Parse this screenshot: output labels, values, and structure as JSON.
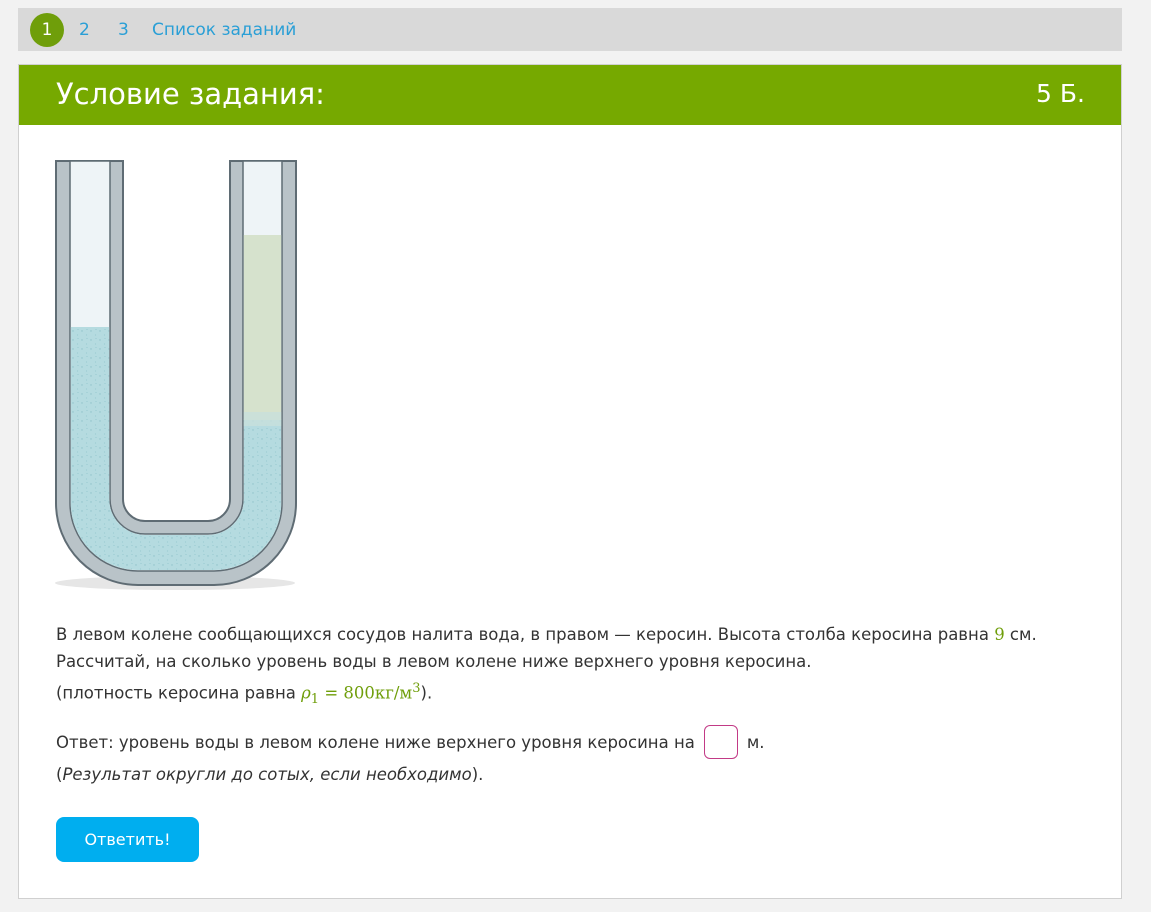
{
  "nav": {
    "tabs": [
      {
        "label": "1",
        "active": true
      },
      {
        "label": "2",
        "active": false
      },
      {
        "label": "3",
        "active": false
      }
    ],
    "task_list": "Список заданий"
  },
  "header": {
    "title": "Условие задания:",
    "points": "5 Б."
  },
  "task": {
    "line1_before": "В левом колене сообщающихся сосудов налита вода, в правом — керосин. Высота столба керосина равна ",
    "height_value": "9",
    "line1_after": " см.",
    "line2": "Рассчитай, на сколько уровень воды в левом колене ниже верхнего уровня керосина.",
    "density_before": "(плотность керосина равна ",
    "rho": "ρ",
    "rho_sub": "1",
    "eq": " = 800",
    "unit": "кг/м",
    "unit_exp": "3",
    "density_after": ")."
  },
  "answer": {
    "before": "Ответ: уровень воды в левом колене ниже верхнего уровня керосина на",
    "value": "",
    "after": "м."
  },
  "hint": {
    "open": "(",
    "text": "Результат округли до сотых, если необходимо",
    "close": ")."
  },
  "submit_label": "Ответить!",
  "colors": {
    "header_green": "#76a900",
    "active_tab": "#6f9e0a",
    "link_blue": "#2a9fd6",
    "button_blue": "#00aeef",
    "water": "#b5dbe0",
    "kerosene": "#d6e2cd",
    "tube_gray": "#b9c3c8"
  }
}
